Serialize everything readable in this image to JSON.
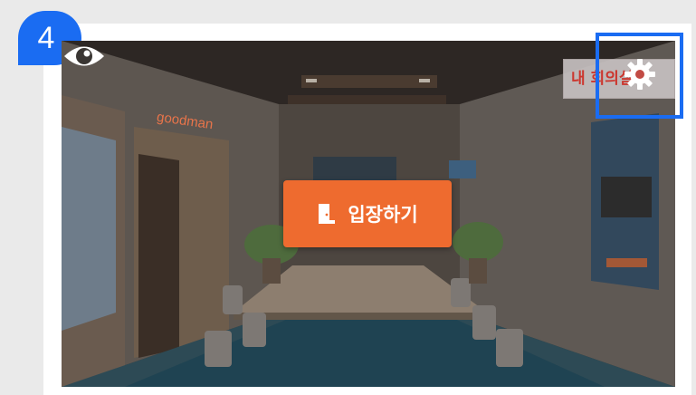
{
  "step": {
    "number": "4"
  },
  "scene": {
    "enter_label": "입장하기",
    "my_room_label": "내 회의실",
    "brand_sign": "goodman"
  },
  "icons": {
    "visibility": "eye-icon",
    "settings": "gear-icon",
    "enter": "door-icon"
  },
  "colors": {
    "accent_blue": "#1a6cf2",
    "enter_orange": "#ee6b2f",
    "label_red": "#d8332a"
  }
}
